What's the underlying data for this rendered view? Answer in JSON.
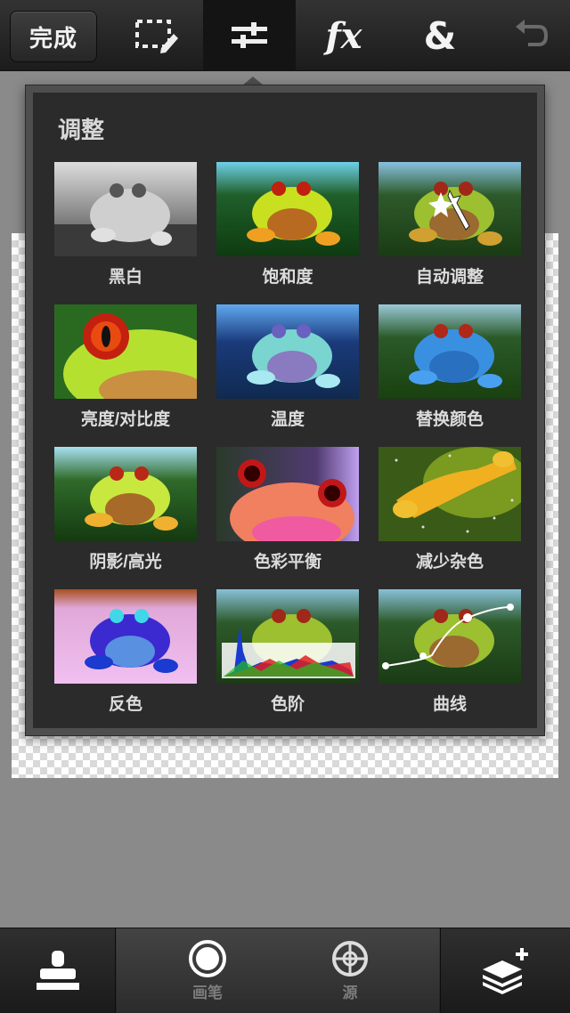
{
  "toolbar": {
    "done_label": "完成",
    "tools": [
      {
        "name": "selection-edit",
        "active": false
      },
      {
        "name": "adjustments",
        "active": true
      },
      {
        "name": "effects",
        "label": "fx",
        "active": false
      },
      {
        "name": "blend",
        "label": "&",
        "active": false
      },
      {
        "name": "undo",
        "active": false
      }
    ]
  },
  "panel": {
    "title": "调整",
    "items": [
      {
        "label": "黑白"
      },
      {
        "label": "饱和度"
      },
      {
        "label": "自动调整"
      },
      {
        "label": "亮度/对比度"
      },
      {
        "label": "温度"
      },
      {
        "label": "替换颜色"
      },
      {
        "label": "阴影/高光"
      },
      {
        "label": "色彩平衡"
      },
      {
        "label": "减少杂色"
      },
      {
        "label": "反色"
      },
      {
        "label": "色阶"
      },
      {
        "label": "曲线"
      }
    ]
  },
  "bottom": {
    "brush_label": "画笔",
    "source_label": "源"
  },
  "colors": {
    "toolbar_bg": "#262626",
    "panel_bg": "#2b2b2b",
    "panel_border": "#4e4e4e",
    "workspace_bg": "#8a8a8a"
  }
}
